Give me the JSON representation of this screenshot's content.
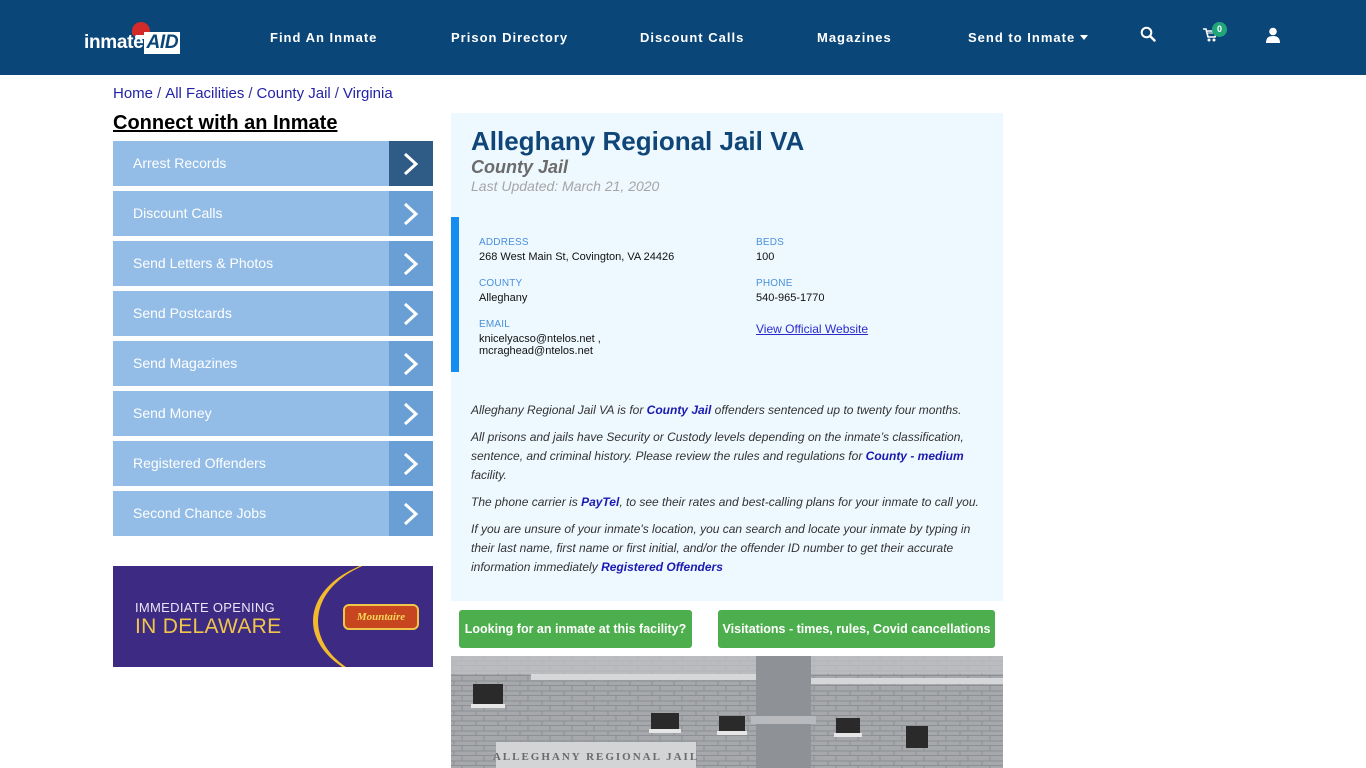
{
  "header": {
    "logo_text": "inmate",
    "logo_accent": "AID",
    "nav": [
      {
        "label": "Find An Inmate"
      },
      {
        "label": "Prison Directory"
      },
      {
        "label": "Discount Calls"
      },
      {
        "label": "Magazines"
      },
      {
        "label": "Send to Inmate",
        "has_dropdown": true
      }
    ],
    "icons": {
      "search": "search-icon",
      "cart": "cart-icon",
      "user": "user-icon"
    },
    "cart_count": "0",
    "colors": {
      "nav_bg": "#0b4678",
      "badge": "#21a67a"
    }
  },
  "breadcrumb": [
    {
      "label": "Home"
    },
    {
      "label": "All Facilities"
    },
    {
      "label": "County Jail"
    },
    {
      "label": "Virginia"
    }
  ],
  "breadcrumb_separator": "/",
  "sidebar": {
    "title": "Connect with an Inmate",
    "items": [
      {
        "label": "Arrest Records"
      },
      {
        "label": "Discount Calls"
      },
      {
        "label": "Send Letters & Photos"
      },
      {
        "label": "Send Postcards"
      },
      {
        "label": "Send Magazines"
      },
      {
        "label": "Send Money"
      },
      {
        "label": "Registered Offenders"
      },
      {
        "label": "Second Chance Jobs"
      }
    ],
    "ad": {
      "line1": "IMMEDIATE OPENING",
      "line2": "IN DELAWARE",
      "brand": "Mountaire"
    }
  },
  "facility": {
    "name": "Alleghany Regional Jail VA",
    "type": "County Jail",
    "last_updated": "Last Updated: March 21, 2020",
    "fields": {
      "address_label": "ADDRESS",
      "address": "268 West Main St, Covington, VA 24426",
      "county_label": "COUNTY",
      "county": "Alleghany",
      "email_label": "EMAIL",
      "email_1": "knicelyacso@ntelos.net ,",
      "email_2": "mcraghead@ntelos.net",
      "beds_label": "BEDS",
      "beds": "100",
      "phone_label": "PHONE",
      "phone": "540-965-1770",
      "website_link": "View Official Website"
    },
    "description": {
      "p1_a": "Alleghany Regional Jail VA is for ",
      "p1_link": "County Jail",
      "p1_b": " offenders sentenced up to twenty four months.",
      "p2_a": "All prisons and jails have Security or Custody levels depending on the inmate’s classification, sentence, and criminal history. Please review the rules and regulations for ",
      "p2_link": "County - medium",
      "p2_b": " facility.",
      "p3_a": "The phone carrier is ",
      "p3_link": "PayTel",
      "p3_b": ", to see their rates and best-calling plans for your inmate to call you.",
      "p4_a": "If you are unsure of your inmate's location, you can search and locate your inmate by typing in their last name, first name or first initial, and/or the offender ID number to get their accurate information immediately ",
      "p4_link": "Registered Offenders"
    },
    "buttons": {
      "looking": "Looking for an inmate at this facility?",
      "visitations": "Visitations - times, rules, Covid cancellations"
    },
    "photo_sign": "ALLEGHANY REGIONAL JAIL"
  }
}
